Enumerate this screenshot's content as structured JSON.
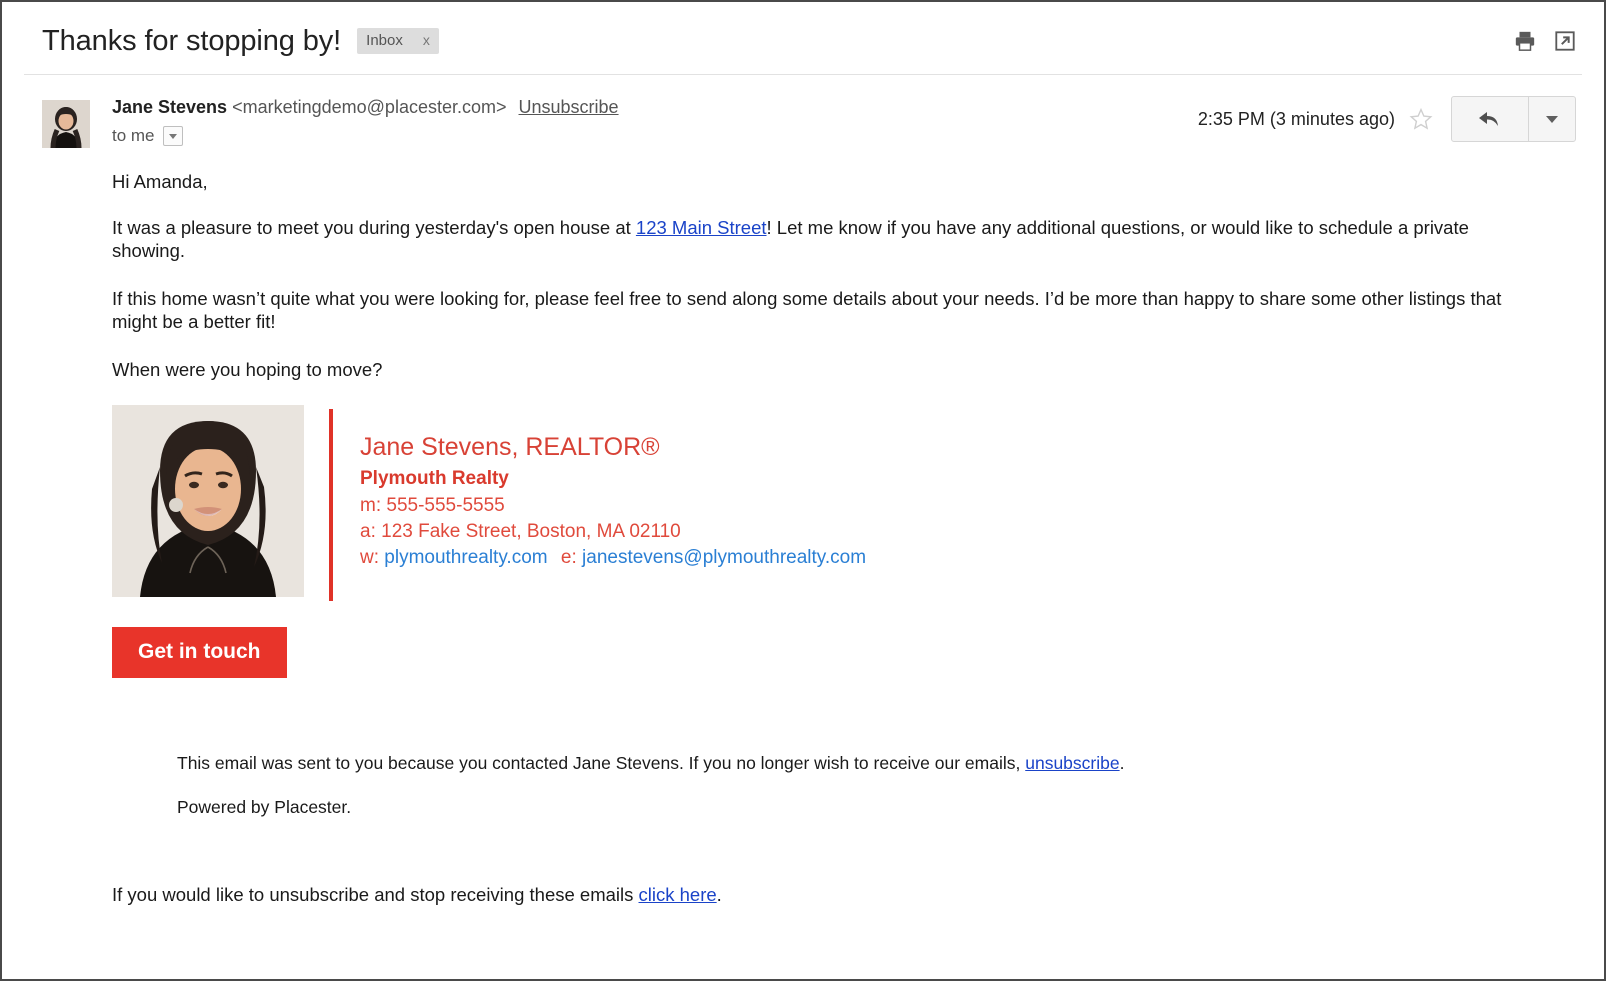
{
  "header": {
    "subject": "Thanks for stopping by!",
    "label": "Inbox",
    "label_close": "x",
    "print_icon": "print-icon",
    "popout_icon": "open-in-new-window-icon"
  },
  "sender": {
    "name": "Jane Stevens",
    "email": "<marketingdemo@placester.com>",
    "unsubscribe_link": "Unsubscribe",
    "recipient": "to me",
    "details_caret_icon": "chevron-down-icon",
    "timestamp": "2:35 PM (3 minutes ago)",
    "star_icon": "star-icon",
    "reply_icon": "reply-arrow-icon",
    "more_icon": "chevron-down-icon",
    "avatar_name": "sender-avatar"
  },
  "body": {
    "greeting": "Hi Amanda,",
    "paragraph1_before": "It was a pleasure to meet you during yesterday's open house at ",
    "paragraph1_link": "123 Main Street",
    "paragraph1_after": "! Let me know if you have any additional questions, or would like to schedule a private showing.",
    "paragraph2": "If this home wasn’t quite what you were looking for, please feel free to send along some details about your needs. I’d be more than happy to share some other listings that might be a better fit!",
    "paragraph3": "When were you hoping to move?"
  },
  "signature": {
    "photo_name": "agent-headshot",
    "name_title": "Jane Stevens, REALTOR®",
    "company": "Plymouth Realty",
    "mobile_label": "m:",
    "mobile_value": "555-555-5555",
    "address_label": "a:",
    "address_value": "123 Fake Street, Boston, MA 02110",
    "web_label": "w:",
    "web_value": "plymouthrealty.com",
    "email_label": "e:",
    "email_value": "janestevens@plymouthrealty.com",
    "cta_label": "Get in touch"
  },
  "footer": {
    "disclaimer_before": "This email was sent to you because you contacted Jane Stevens. If you no longer wish to receive our emails, ",
    "disclaimer_link": "unsubscribe",
    "disclaimer_after": ".",
    "powered_by": "Powered by Placester.",
    "tail_before": "If you would like to unsubscribe and stop receiving these emails ",
    "tail_link": "click here",
    "tail_after": "."
  },
  "colors": {
    "brand_red": "#e8342a",
    "signature_red": "#d84236",
    "link_blue": "#1a43c8",
    "signature_link_blue": "#2a7fd4",
    "chip_gray": "#dddddd"
  }
}
